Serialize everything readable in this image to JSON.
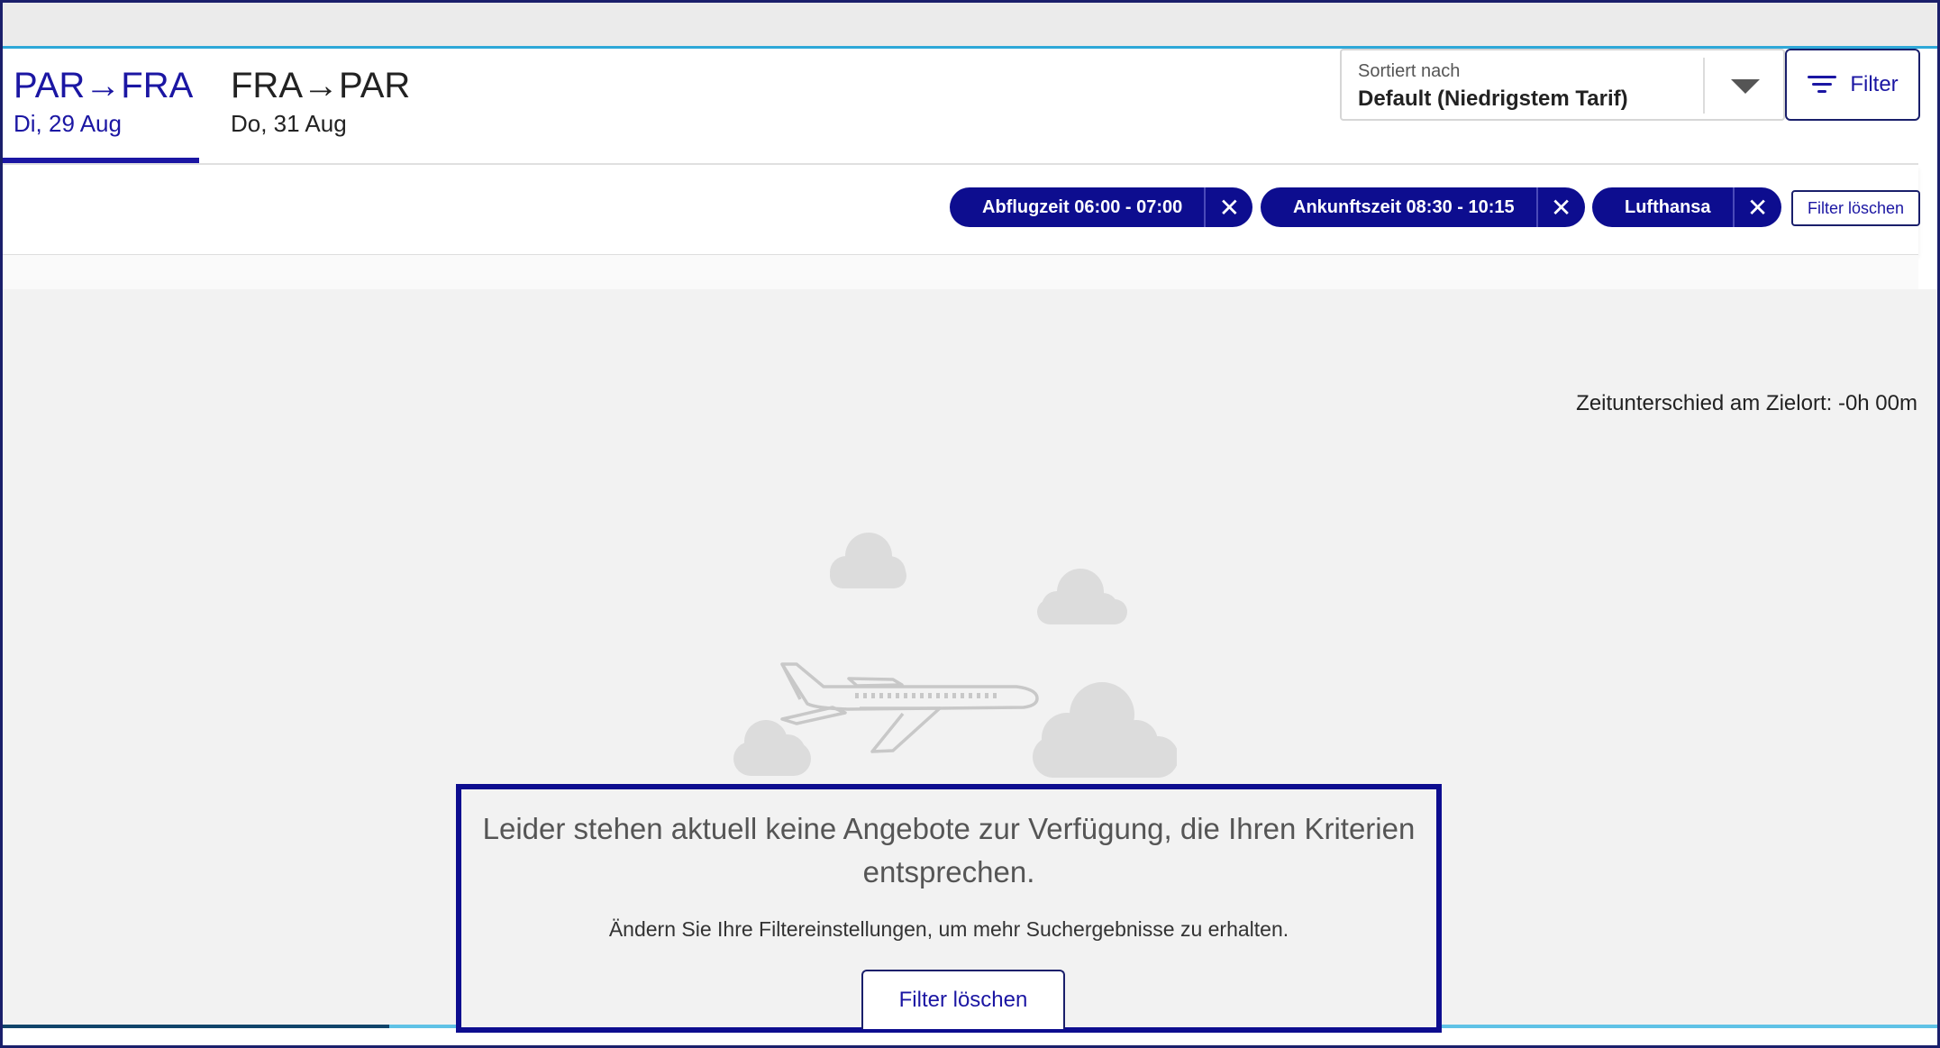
{
  "tabs": {
    "outbound": {
      "route": "PAR→FRA",
      "date": "Di, 29 Aug",
      "active": true
    },
    "return": {
      "route": "FRA→PAR",
      "date": "Do, 31 Aug",
      "active": false
    }
  },
  "sort": {
    "label": "Sortiert nach",
    "value": "Default (Niedrigstem Tarif)"
  },
  "filter_button": {
    "label": "Filter",
    "icon": "filter-lines-icon"
  },
  "chips": [
    {
      "label": "Abflugzeit 06:00 - 07:00",
      "remove_icon": "close-icon"
    },
    {
      "label": "Ankunftszeit 08:30 - 10:15",
      "remove_icon": "close-icon"
    },
    {
      "label": "Lufthansa",
      "remove_icon": "close-icon"
    }
  ],
  "chip_remove_glyph": "✕",
  "clear_filters_small": "Filter löschen",
  "timezone_diff": "Zeitunterschied am Zielort: -0h 00m",
  "empty_state": {
    "illustration": "airplane-clouds-illustration",
    "title": "Leider stehen aktuell keine Angebote zur Verfügung, die Ihren Kriterien entsprechen.",
    "subtitle": "Ändern Sie Ihre Filtereinstellungen, um mehr Suchergebnisse zu erhalten.",
    "clear_button": "Filter löschen"
  },
  "colors": {
    "primary": "#1b16a3",
    "chip_bg": "#0d0d8f",
    "frame": "#1a1f6b",
    "accent_line": "#2ea8d8",
    "content_bg": "#f2f2f2",
    "illustration": "#d9d9d9"
  },
  "progress": {
    "fraction": 0.2
  }
}
